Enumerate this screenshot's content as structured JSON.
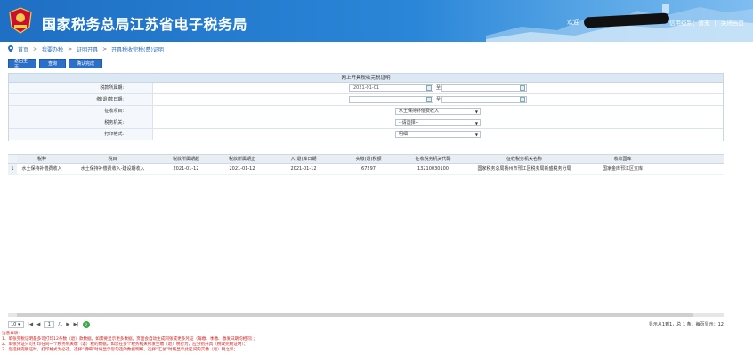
{
  "header": {
    "site_title": "国家税务总局江苏省电子税务局",
    "emblem_text": "中国税务",
    "welcome": "欢迎",
    "links": [
      "信用级别：暂无",
      "|",
      "关闭当页"
    ]
  },
  "breadcrumb": [
    "首页",
    ">",
    "我要办税",
    ">",
    "证明开具",
    ">",
    "开具税收完税(费)证明"
  ],
  "toolbar": {
    "back_label": "返回主页",
    "query_label": "查询",
    "confirm_label": "确认完成"
  },
  "form": {
    "title": "网上开具税收完税证明",
    "tax_period_label": "税款所属期:",
    "tax_period_start": "2021-01-01",
    "tax_period_to": "至",
    "payment_date_label": "缴(退)款日期:",
    "payment_date_to": "至",
    "item_label": "征收项目:",
    "item_value": "水土保持补偿费收入",
    "authority_label": "税务机关:",
    "authority_value": "--请选择--",
    "print_label": "打印格式:",
    "print_value": "明细"
  },
  "grid": {
    "headers": [
      "",
      "税种",
      "税目",
      "税款所属期起",
      "税款所属期止",
      "入(退)库日期",
      "实缴(退)税额",
      "征收税务机关代码",
      "征收税务机关名称",
      "收款国库"
    ],
    "rows": [
      [
        "1",
        "水土保持补偿费收入",
        "水土保持补偿费收入-建设期收入",
        "2021-01-12",
        "2021-01-12",
        "2021-01-12",
        "67297",
        "13210030100",
        "国家税务总局扬州市邗江区税务局新盛税务分局",
        "国家金库邗江区支库"
      ]
    ]
  },
  "pager": {
    "page_size": "10",
    "page_input": "1",
    "page_total": "/1",
    "info": "显示从1到1，总 1 条，每页显示：12"
  },
  "notes": [
    "注意事项:",
    "1、单张完税证明最多可打印12条数（退）款数据。如需要显示更多数据，页面会自动生成同张或更多凭证（每缴、季缴、缴发日期均相同）；",
    "2、单张凭证只可打印在同一个税务机关缴（退）税的数据。如您在多个税务机关所发生缴（退）税行为，应分别开具（税收完税证明）；",
    "3、您选择完税证时，打印格式为必选，选择“明细”时将显示您勾选的数据明细，选择“汇总”时将显示此区间内实缴（退）税之和；"
  ],
  "colors": {
    "header_blue": "#2a86d8",
    "button_blue": "#2d6fc6",
    "note_red": "#d01f1f"
  }
}
